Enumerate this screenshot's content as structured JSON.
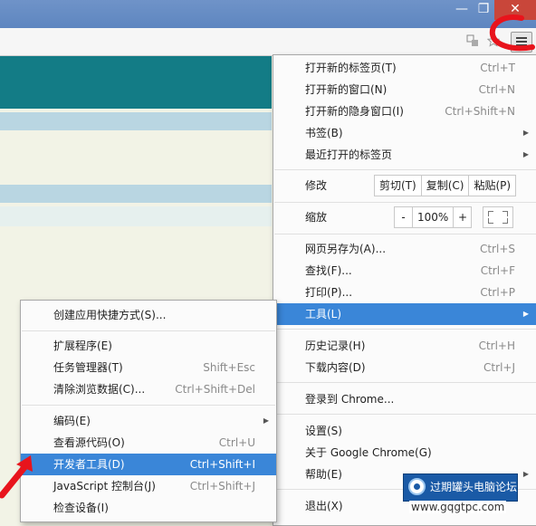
{
  "main_menu": {
    "items": [
      {
        "label": "打开新的标签页(T)",
        "shortcut": "Ctrl+T"
      },
      {
        "label": "打开新的窗口(N)",
        "shortcut": "Ctrl+N"
      },
      {
        "label": "打开新的隐身窗口(I)",
        "shortcut": "Ctrl+Shift+N"
      },
      {
        "label": "书签(B)"
      },
      {
        "label": "最近打开的标签页"
      },
      {
        "label": "网页另存为(A)...",
        "shortcut": "Ctrl+S"
      },
      {
        "label": "查找(F)...",
        "shortcut": "Ctrl+F"
      },
      {
        "label": "打印(P)...",
        "shortcut": "Ctrl+P"
      },
      {
        "label": "工具(L)"
      },
      {
        "label": "历史记录(H)",
        "shortcut": "Ctrl+H"
      },
      {
        "label": "下载内容(D)",
        "shortcut": "Ctrl+J"
      },
      {
        "label": "登录到 Chrome..."
      },
      {
        "label": "设置(S)"
      },
      {
        "label": "关于 Google Chrome(G)"
      },
      {
        "label": "帮助(E)"
      },
      {
        "label": "退出(X)"
      }
    ],
    "edit": {
      "label": "修改",
      "cut": "剪切(T)",
      "copy": "复制(C)",
      "paste": "粘贴(P)"
    },
    "zoom": {
      "label": "缩放",
      "minus": "-",
      "value": "100%",
      "plus": "+"
    }
  },
  "tools_submenu": {
    "items": [
      {
        "label": "创建应用快捷方式(S)..."
      },
      {
        "label": "扩展程序(E)"
      },
      {
        "label": "任务管理器(T)",
        "shortcut": "Shift+Esc"
      },
      {
        "label": "清除浏览数据(C)...",
        "shortcut": "Ctrl+Shift+Del"
      },
      {
        "label": "编码(E)"
      },
      {
        "label": "查看源代码(O)",
        "shortcut": "Ctrl+U"
      },
      {
        "label": "开发者工具(D)",
        "shortcut": "Ctrl+Shift+I"
      },
      {
        "label": "JavaScript 控制台(J)",
        "shortcut": "Ctrl+Shift+J"
      },
      {
        "label": "检查设备(I)"
      }
    ]
  },
  "window_controls": {
    "minimize": "—",
    "maximize": "❐",
    "close": "✕"
  },
  "watermark": {
    "badge_text": "过期罐头电脑论坛",
    "url": "www.gqgtpc.com"
  },
  "colors": {
    "highlight": "#3a86d8",
    "annotation": "#e8141c",
    "teal_band": "#137c86"
  },
  "icons": [
    "translate-icon",
    "star-icon",
    "menu-icon",
    "submenu-arrow-icon",
    "fullscreen-icon"
  ]
}
